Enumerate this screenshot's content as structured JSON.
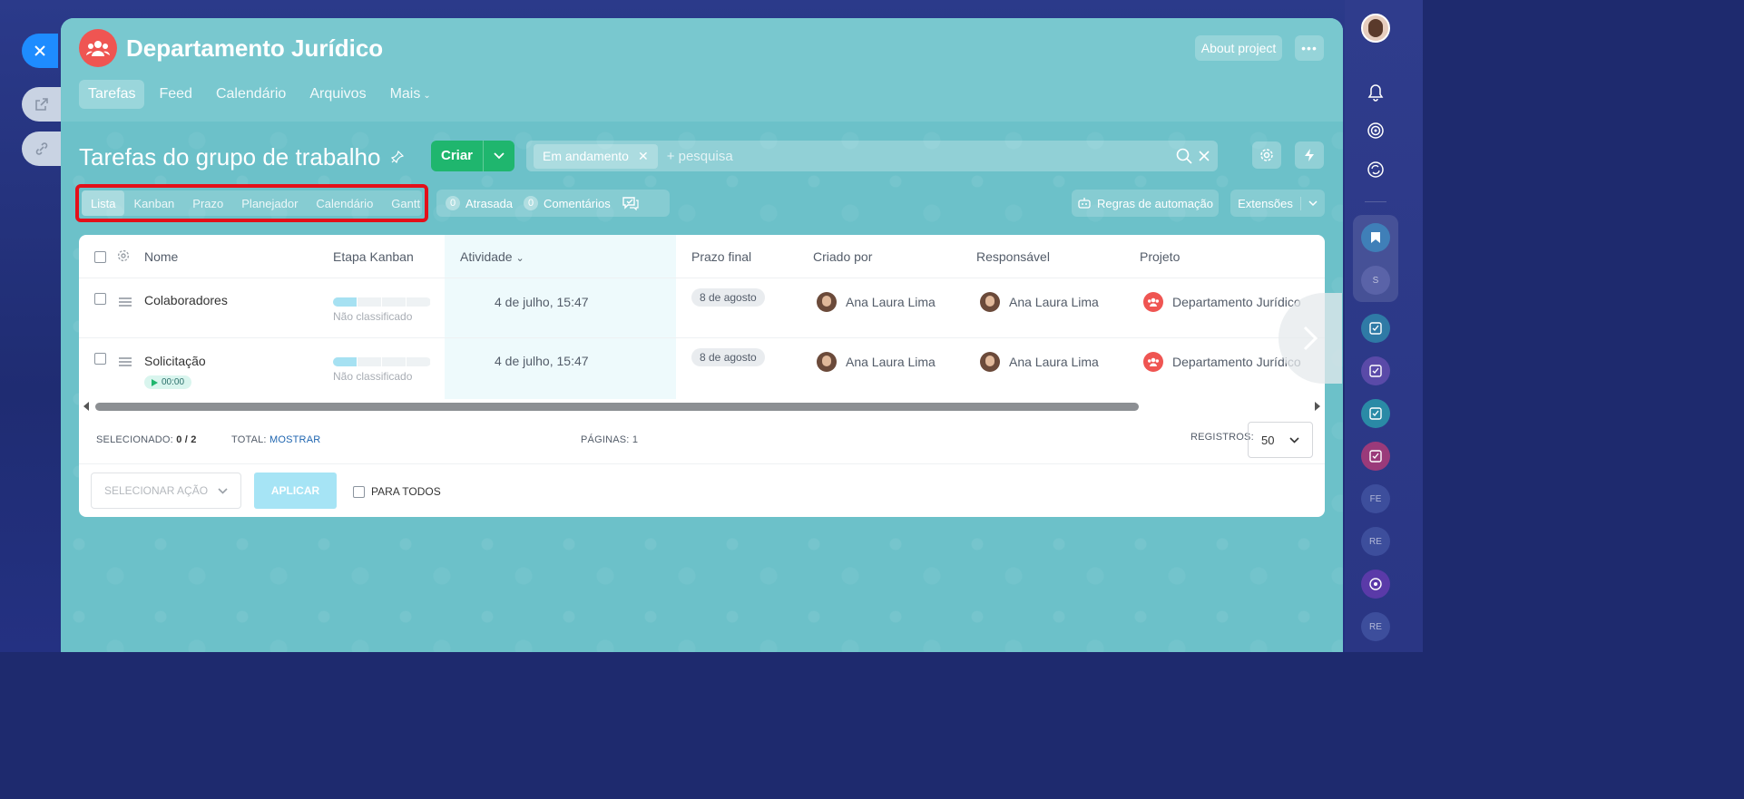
{
  "group": {
    "title": "Departamento Jurídico",
    "about_label": "About project",
    "more_label": "•••"
  },
  "topnav": [
    {
      "label": "Tarefas",
      "active": true
    },
    {
      "label": "Feed",
      "active": false
    },
    {
      "label": "Calendário",
      "active": false
    },
    {
      "label": "Arquivos",
      "active": false
    },
    {
      "label": "Mais",
      "active": false
    }
  ],
  "page": {
    "title": "Tarefas do grupo de trabalho",
    "create_label": "Criar",
    "filter_chip": "Em andamento",
    "search_placeholder": "+ pesquisa"
  },
  "view_tabs": [
    {
      "label": "Lista",
      "active": true
    },
    {
      "label": "Kanban",
      "active": false
    },
    {
      "label": "Prazo",
      "active": false
    },
    {
      "label": "Planejador",
      "active": false
    },
    {
      "label": "Calendário",
      "active": false
    },
    {
      "label": "Gantt",
      "active": false
    }
  ],
  "counters": {
    "overdue_count": "0",
    "overdue_label": "Atrasada",
    "comments_count": "0",
    "comments_label": "Comentários"
  },
  "toolbar": {
    "automation_label": "Regras de automação",
    "extensions_label": "Extensões"
  },
  "grid": {
    "columns": {
      "name": "Nome",
      "kanban": "Etapa Kanban",
      "activity": "Atividade",
      "deadline": "Prazo final",
      "created_by": "Criado por",
      "responsible": "Responsável",
      "project": "Projeto"
    },
    "rows": [
      {
        "name": "Colaboradores",
        "stage": "Não classificado",
        "activity": "4 de julho, 15:47",
        "deadline": "8 de agosto",
        "created_by": "Ana Laura Lima",
        "responsible": "Ana Laura Lima",
        "project": "Departamento Jurídico",
        "timer": ""
      },
      {
        "name": "Solicitação",
        "stage": "Não classificado",
        "activity": "4 de julho, 15:47",
        "deadline": "8 de agosto",
        "created_by": "Ana Laura Lima",
        "responsible": "Ana Laura Lima",
        "project": "Departamento Jurídico",
        "timer": "00:00"
      }
    ]
  },
  "footer": {
    "selected_label": "SELECIONADO:",
    "selected_value": "0 / 2",
    "total_label": "TOTAL:",
    "total_link": "MOSTRAR",
    "pages_label": "PÁGINAS:",
    "pages_value": "1",
    "records_label": "REGISTROS:",
    "records_value": "50",
    "action_placeholder": "SELECIONAR AÇÃO",
    "apply_label": "APLICAR",
    "for_all_label": "PARA TODOS"
  },
  "right_bar": {
    "items_text": [
      "S",
      "FE",
      "RE",
      "RE"
    ]
  },
  "colors": {
    "accent": "#1fb66e",
    "panel_bg": "#6cc1c9",
    "group_avatar": "#ef5552",
    "highlight_border": "#e3101a"
  }
}
